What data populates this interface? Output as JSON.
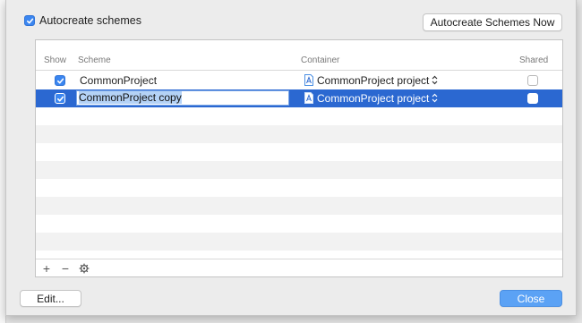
{
  "autocreate": {
    "label": "Autocreate schemes",
    "checked": true
  },
  "buttons": {
    "now": "Autocreate Schemes Now",
    "edit": "Edit...",
    "close": "Close"
  },
  "table": {
    "headers": {
      "show": "Show",
      "scheme": "Scheme",
      "container": "Container",
      "shared": "Shared"
    },
    "rows": [
      {
        "show": true,
        "scheme": "CommonProject",
        "container": "CommonProject project",
        "shared": false,
        "selected": false,
        "editing": false
      },
      {
        "show": true,
        "scheme": "CommonProject copy",
        "container": "CommonProject project",
        "shared": false,
        "selected": true,
        "editing": true
      }
    ]
  },
  "footer": {
    "add": "+",
    "remove": "−"
  },
  "icons": {
    "add": "plus-icon",
    "remove": "minus-icon",
    "action": "gear-icon",
    "file": "xcode-project-icon",
    "stepper": "chevron-updown-icon"
  },
  "colors": {
    "accent": "#2b68d1",
    "checkbox": "#3b86f0",
    "close_button": "#5ba2f5"
  }
}
